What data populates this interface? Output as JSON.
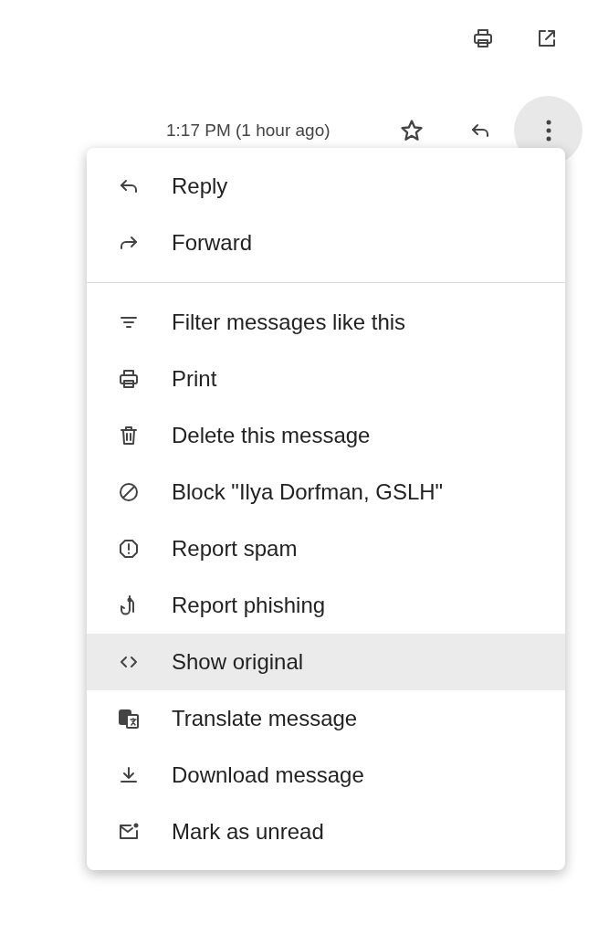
{
  "header": {
    "time": "1:17 PM (1 hour ago)",
    "more_button": {
      "expanded": true
    }
  },
  "menu": {
    "sections": [
      [
        {
          "label": "Reply",
          "selected": false
        },
        {
          "label": "Forward",
          "selected": false
        }
      ],
      [
        {
          "label": "Filter messages like this",
          "selected": false
        },
        {
          "label": "Print",
          "selected": false
        },
        {
          "label": "Delete this message",
          "selected": false
        },
        {
          "label": "Block \"Ilya Dorfman, GSLH\"",
          "selected": false
        },
        {
          "label": "Report spam",
          "selected": false
        },
        {
          "label": "Report phishing",
          "selected": false
        },
        {
          "label": "Show original",
          "selected": true
        },
        {
          "label": "Translate message",
          "selected": false
        },
        {
          "label": "Download message",
          "selected": false
        },
        {
          "label": "Mark as unread",
          "selected": false
        }
      ]
    ]
  }
}
